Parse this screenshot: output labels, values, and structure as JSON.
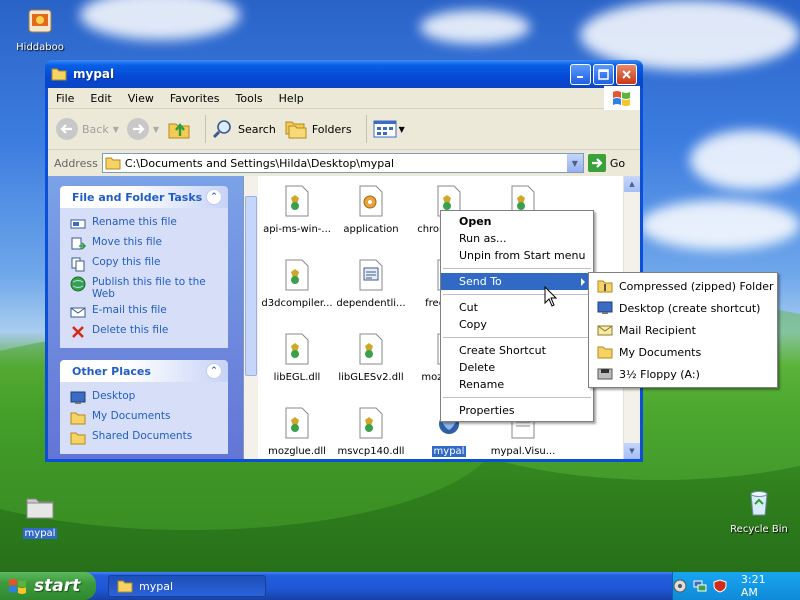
{
  "desktop": {
    "icons": [
      {
        "label": "Hiddaboo"
      },
      {
        "label": "mypal"
      },
      {
        "label": "Recycle Bin"
      }
    ]
  },
  "window": {
    "title": "mypal",
    "menu": [
      "File",
      "Edit",
      "View",
      "Favorites",
      "Tools",
      "Help"
    ],
    "toolbar": {
      "back": "Back",
      "search": "Search",
      "folders": "Folders"
    },
    "address": {
      "label": "Address",
      "path": "C:\\Documents and Settings\\Hilda\\Desktop\\mypal",
      "go": "Go"
    },
    "tasks": {
      "file_folder": {
        "title": "File and Folder Tasks",
        "items": [
          "Rename this file",
          "Move this file",
          "Copy this file",
          "Publish this file to the Web",
          "E-mail this file",
          "Delete this file"
        ]
      },
      "other_places": {
        "title": "Other Places",
        "items": [
          "Desktop",
          "My Documents",
          "Shared Documents"
        ]
      }
    },
    "files": [
      {
        "name": "api-ms-win-...",
        "icon": "dll-icon"
      },
      {
        "name": "application",
        "icon": "config-icon"
      },
      {
        "name": "chrom",
        "icon": "dll-icon"
      },
      {
        "name": "",
        "icon": "dll-icon"
      },
      {
        "name": "d3dcompiler...",
        "icon": "dll-icon"
      },
      {
        "name": "dependentli...",
        "icon": "document-icon"
      },
      {
        "name": "free",
        "icon": "dll-icon"
      },
      {
        "name": "libEGL.dll",
        "icon": "dll-icon"
      },
      {
        "name": "libGLESv2.dll",
        "icon": "dll-icon"
      },
      {
        "name": "moza",
        "icon": "dll-icon"
      },
      {
        "name": "mozglue.dll",
        "icon": "dll-icon"
      },
      {
        "name": "msvcp140.dll",
        "icon": "dll-icon"
      },
      {
        "name": "mypal",
        "icon": "app-icon"
      },
      {
        "name": "mypal.Visu...",
        "icon": "document-icon"
      }
    ]
  },
  "context_menu": {
    "items": [
      "Open",
      "Run as...",
      "Unpin from Start menu",
      "Send To",
      "Cut",
      "Copy",
      "Create Shortcut",
      "Delete",
      "Rename",
      "Properties"
    ],
    "highlighted": "Send To"
  },
  "send_to_menu": {
    "items": [
      "Compressed (zipped) Folder",
      "Desktop (create shortcut)",
      "Mail Recipient",
      "My Documents",
      "3½ Floppy (A:)"
    ]
  },
  "taskbar": {
    "start": "start",
    "task_button": "mypal",
    "clock": "3:21 AM"
  },
  "colors": {
    "selection": "#316ac5",
    "taskbar": "#245edb",
    "start": "#3c9a3c"
  }
}
